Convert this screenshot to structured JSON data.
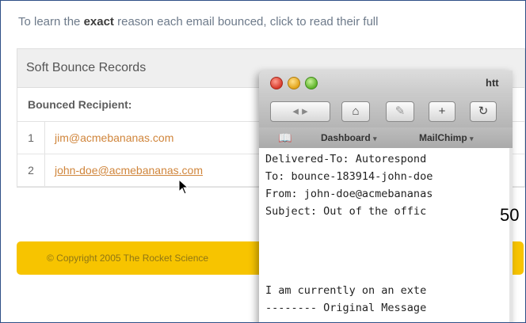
{
  "intro": {
    "before": "To learn the ",
    "bold": "exact",
    "after": " reason each email bounced, click to read their full"
  },
  "panel": {
    "title": "Soft Bounce Records",
    "column_header": "Bounced Recipient:",
    "rows": [
      {
        "num": "1",
        "email": "jim@acmebananas.com"
      },
      {
        "num": "2",
        "email": "john-doe@acmebananas.com"
      }
    ]
  },
  "footer": {
    "text": "© Copyright 2005 The Rocket Science"
  },
  "overlay_number": "50",
  "browser": {
    "title": "htt",
    "toolbar": {
      "nav_glyph": "◂ ▸",
      "home_glyph": "⌂",
      "edit_glyph": "✎",
      "add_glyph": "+",
      "reload_glyph": "↻"
    },
    "bookmarks": {
      "book_glyph": "📖",
      "items": [
        {
          "label": "Dashboard",
          "caret": "▾"
        },
        {
          "label": "MailChimp",
          "caret": "▾"
        }
      ]
    },
    "message_lines": [
      "Delivered-To: Autorespond",
      "To: bounce-183914-john-doe",
      "From: john-doe@acmebananas",
      "Subject: Out of the offic",
      "",
      "",
      "",
      "I am currently on an exte",
      "-------- Original Message"
    ]
  }
}
